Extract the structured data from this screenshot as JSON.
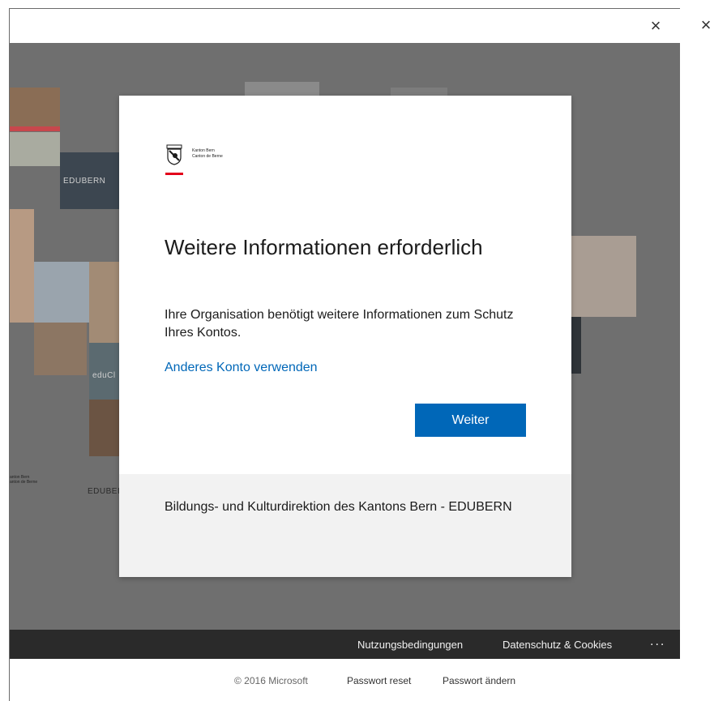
{
  "window": {
    "close_glyph": "×",
    "inner_close_glyph": "×"
  },
  "background": {
    "tile_label_1": "EDUBERN",
    "tile_label_2": "eduCl",
    "tile_label_3": "EDUBEI",
    "bg_logo_line1": "anton Bern",
    "bg_logo_line2": "anton de Berne"
  },
  "card": {
    "logo_line1": "Kanton Bern",
    "logo_line2": "Canton de Berne",
    "heading": "Weitere Informationen erforderlich",
    "description": "Ihre Organisation benötigt weitere Informationen zum Schutz Ihres Kontos.",
    "alt_account_link": "Anderes Konto verwenden",
    "next_button": "Weiter",
    "organization": "Bildungs- und Kulturdirektion des Kantons Bern - EDUBERN"
  },
  "footer_dark": {
    "terms": "Nutzungsbedingungen",
    "privacy": "Datenschutz & Cookies",
    "more": "..."
  },
  "footer_light": {
    "copyright": "© 2016 Microsoft",
    "password_reset": "Passwort reset",
    "password_change": "Passwort ändern"
  },
  "colors": {
    "accent": "#0067b8",
    "brand_red": "#e3001b",
    "backdrop": "#6f6f6f",
    "footer_dark": "#2a2a2a"
  }
}
